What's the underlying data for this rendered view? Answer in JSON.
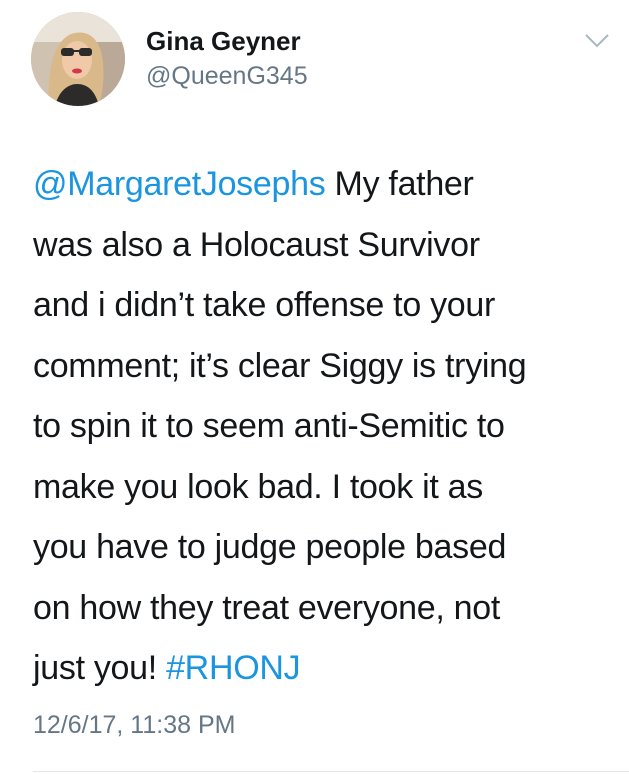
{
  "tweet": {
    "author": {
      "display_name": "Gina Geyner",
      "handle": "@QueenG345"
    },
    "menu_icon": "chevron-down-icon",
    "body_lines": [
      {
        "mention": "@MargaretJosephs",
        "text": " My father"
      },
      {
        "text": "was also a Holocaust Survivor"
      },
      {
        "text": "and i didn’t take offense to your"
      },
      {
        "text": "comment; it’s clear Siggy is trying"
      },
      {
        "text": "to spin it to seem anti-Semitic to"
      },
      {
        "text": "make you look bad. I took it as"
      },
      {
        "text": "you have to judge people based"
      },
      {
        "text": "on how they treat everyone, not"
      },
      {
        "text": "just you! ",
        "hashtag": "#RHONJ"
      }
    ],
    "timestamp": "12/6/17, 11:38 PM",
    "colors": {
      "link": "#1b95e0",
      "secondary_text": "#657786",
      "primary_text": "#14171a",
      "divider": "#e1e8ed"
    }
  }
}
